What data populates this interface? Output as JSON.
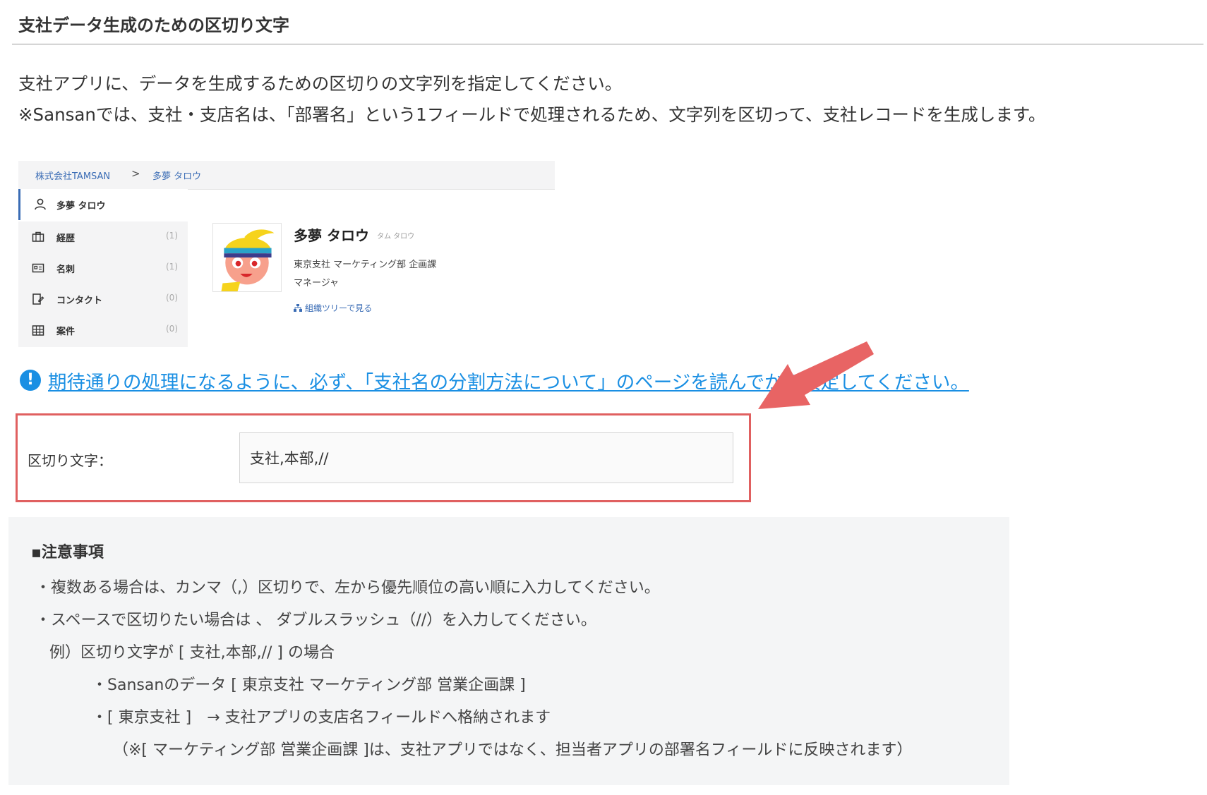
{
  "section": {
    "title": "支社データ生成のための区切り文字",
    "description_1": "支社アプリに、データを生成するための区切りの文字列を指定してください。",
    "description_2": "※Sansanでは、支社・支店名は、「部署名」という1フィールドで処理されるため、文字列を区切って、支社レコードを生成します。"
  },
  "embedded_screen": {
    "breadcrumb": {
      "company": "株式会社TAMSAN",
      "separator": ">",
      "person": "多夢 タロウ"
    },
    "sidebar": {
      "items": [
        {
          "label": "多夢 タロウ",
          "count": "",
          "icon": "person-icon"
        },
        {
          "label": "経歴",
          "count": "(1)",
          "icon": "briefcase-icon"
        },
        {
          "label": "名刺",
          "count": "(1)",
          "icon": "card-icon"
        },
        {
          "label": "コンタクト",
          "count": "(0)",
          "icon": "contact-icon"
        },
        {
          "label": "案件",
          "count": "(0)",
          "icon": "building-icon"
        }
      ]
    },
    "profile": {
      "name": "多夢 タロウ",
      "kana": "タム タロウ",
      "department": "東京支社 マーケティング部 企画課",
      "role": "マネージャ",
      "org_link": "組織ツリーで見る"
    }
  },
  "notice": {
    "icon": "!",
    "text": "期待通りの処理になるように、必ず、「支社名の分割方法について」のページを読んでから設定してください。"
  },
  "setting": {
    "label": "区切り文字：",
    "value": "支社,本部,//"
  },
  "notes": {
    "title": "▪注意事項",
    "line_1": "・複数ある場合は、カンマ（,）区切りで、左から優先順位の高い順に入力してください。",
    "line_2": "・スペースで区切りたい場合は 、 ダブルスラッシュ（//）を入力してください。",
    "line_3": "例）区切り文字が [ 支社,本部,// ] の場合",
    "line_4": "・Sansanのデータ [ 東京支社 マーケティング部 営業企画課 ]",
    "line_5": "・[ 東京支社 ]　→ 支社アプリの支店名フィールドへ格納されます",
    "line_6": "（※[ マーケティング部 営業企画課 ]は、支社アプリではなく、担当者アプリの部署名フィールドに反映されます）"
  },
  "colors": {
    "link": "#1a8fe3",
    "highlight_border": "#e06060",
    "arrow": "#e86464",
    "notes_background": "#f4f5f6"
  }
}
